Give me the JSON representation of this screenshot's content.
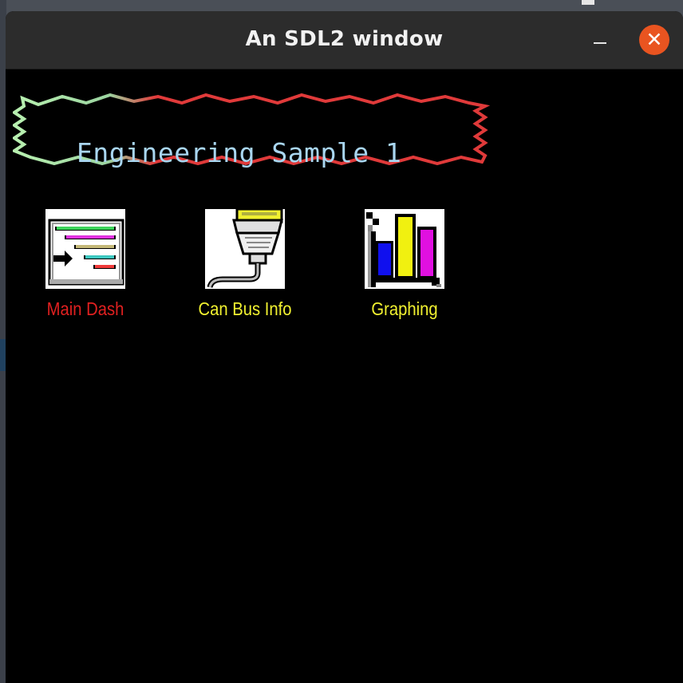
{
  "window": {
    "title": "An SDL2 window",
    "close_glyph": "✕"
  },
  "banner": {
    "title": "Engineering Sample 1",
    "text_color": "#a9d6f0",
    "border_colors": [
      "#b8f0b0",
      "#e03a3a"
    ]
  },
  "apps": [
    {
      "label": "Main Dash",
      "color": "#e02020",
      "icon": "dashboard-icon"
    },
    {
      "label": "Can Bus Info",
      "color": "#f2f230",
      "icon": "serial-connector-icon"
    },
    {
      "label": "Graphing",
      "color": "#f2f230",
      "icon": "bar-chart-icon"
    }
  ],
  "colors": {
    "titlebar": "#2c2c2c",
    "close_button": "#e95420",
    "background": "#000000"
  }
}
